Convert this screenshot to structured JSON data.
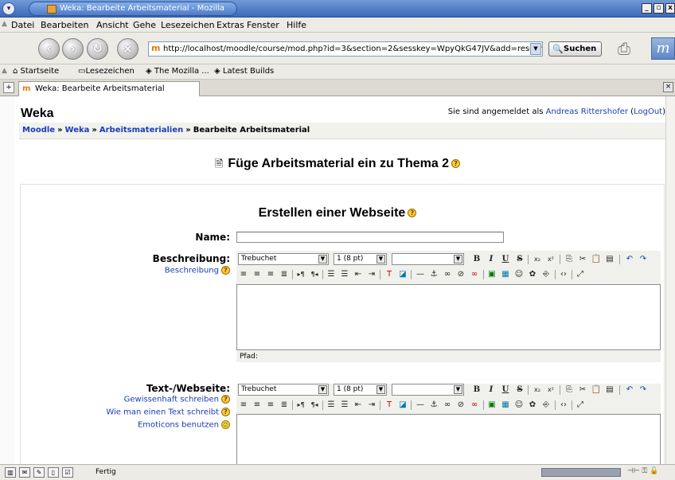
{
  "window": {
    "title": "Weka: Bearbeite Arbeitsmaterial - Mozilla",
    "controls": [
      "_",
      "▫",
      "x"
    ]
  },
  "menu": [
    "Datei",
    "Bearbeiten",
    "Ansicht",
    "Gehe",
    "Lesezeichen",
    "Extras",
    "Fenster",
    "Hilfe"
  ],
  "nav": {
    "url": "http://localhost/moodle/course/mod.php?id=3&section=2&sesskey=WpyQkG47JV&add=resource",
    "search_label": "Suchen"
  },
  "bookmarks": [
    "Startseite",
    "Lesezeichen",
    "The Mozilla ...",
    "Latest Builds"
  ],
  "tab": {
    "label": "Weka: Bearbeite Arbeitsmaterial"
  },
  "page": {
    "site_name": "Weka",
    "login_prefix": "Sie sind angemeldet als",
    "login_user": "Andreas Rittershofer",
    "login_logout": "LogOut",
    "breadcrumbs": [
      "Moodle",
      "Weka",
      "Arbeitsmaterialien",
      "Bearbeite Arbeitsmaterial"
    ],
    "breadcrumb_sep": "»",
    "heading": "Füge Arbeitsmaterial ein zu Thema 2",
    "form_title": "Erstellen einer Webseite",
    "fields": {
      "name_label": "Name:",
      "name_value": "",
      "desc_label": "Beschreibung:",
      "desc_help": "Beschreibung",
      "path_label": "Pfad:",
      "text_label": "Text-/Webseite:",
      "text_help_1": "Gewissenhaft schreiben",
      "text_help_2": "Wie man einen Text schreibt",
      "text_help_3": "Emoticons benutzen"
    },
    "editor": {
      "font": "Trebuchet",
      "size": "1 (8 pt)",
      "style": ""
    }
  },
  "status": {
    "text": "Fertig",
    "icons": [
      "navigator-icon",
      "mail-icon",
      "composer-icon",
      "addressbook-icon",
      "chat-icon"
    ]
  }
}
